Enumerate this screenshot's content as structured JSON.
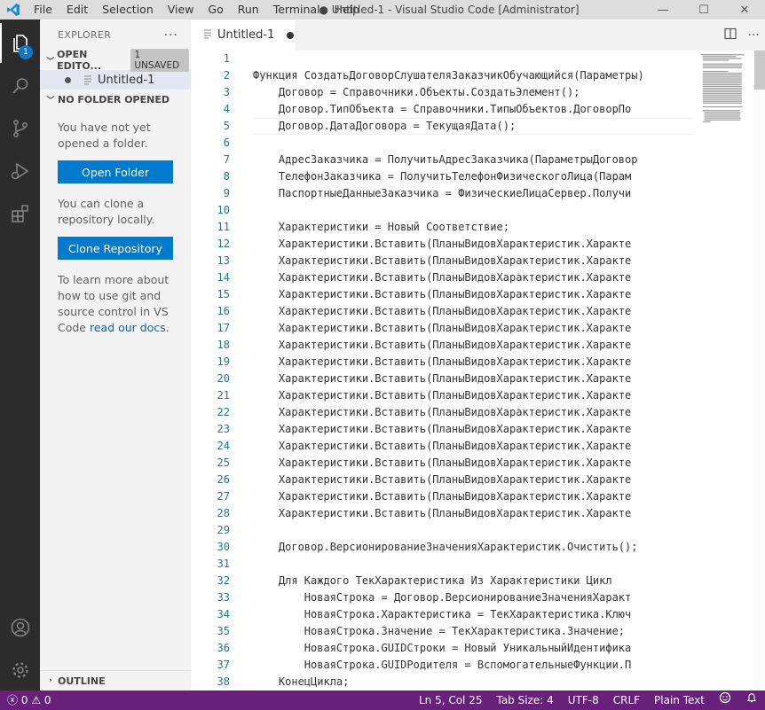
{
  "titlebar": {
    "menu": [
      "File",
      "Edit",
      "Selection",
      "View",
      "Go",
      "Run",
      "Terminal",
      "Help"
    ],
    "window_title": "● Untitled-1 - Visual Studio Code [Administrator]",
    "controls": {
      "minimize": "—",
      "maximize": "☐",
      "close": "✕"
    }
  },
  "activitybar": {
    "items": [
      "files-icon",
      "search-icon",
      "source-control-icon",
      "run-debug-icon",
      "extensions-icon"
    ],
    "explorer_badge": "1",
    "bottom": [
      "account-icon",
      "gear-icon"
    ]
  },
  "sidebar": {
    "title": "EXPLORER",
    "more": "···",
    "open_editors": {
      "label": "OPEN EDITO...",
      "badge": "1 UNSAVED",
      "file": "Untitled-1"
    },
    "no_folder": {
      "label": "NO FOLDER OPENED",
      "msg1": "You have not yet opened a folder.",
      "open_folder_button": "Open Folder",
      "msg2": "You can clone a repository locally.",
      "clone_button": "Clone Repository",
      "msg3_prefix": "To learn more about how to use git and source control in VS Code ",
      "msg3_link": "read our docs",
      "msg3_suffix": "."
    },
    "outline": "OUTLINE"
  },
  "editor": {
    "tab_label": "Untitled-1",
    "lines": [
      "",
      "Функция СоздатьДоговорСлушателяЗаказчикОбучающийся(Параметры)",
      "    Договор = Справочники.Объекты.СоздатьЭлемент();",
      "    Договор.ТипОбъекта = Справочники.ТипыОбъектов.ДоговорПо",
      "    Договор.ДатаДоговора = ТекущаяДата();",
      "",
      "    АдресЗаказчика = ПолучитьАдресЗаказчика(ПараметрыДоговор",
      "    ТелефонЗаказчика = ПолучитьТелефонФизическогоЛица(Парам",
      "    ПаспортныеДанныеЗаказчика = ФизическиеЛицаСервер.Получи",
      "",
      "    Характеристики = Новый Соответствие;",
      "    Характеристики.Вставить(ПланыВидовХарактеристик.Характе",
      "    Характеристики.Вставить(ПланыВидовХарактеристик.Характе",
      "    Характеристики.Вставить(ПланыВидовХарактеристик.Характе",
      "    Характеристики.Вставить(ПланыВидовХарактеристик.Характе",
      "    Характеристики.Вставить(ПланыВидовХарактеристик.Характе",
      "    Характеристики.Вставить(ПланыВидовХарактеристик.Характе",
      "    Характеристики.Вставить(ПланыВидовХарактеристик.Характе",
      "    Характеристики.Вставить(ПланыВидовХарактеристик.Характе",
      "    Характеристики.Вставить(ПланыВидовХарактеристик.Характе",
      "    Характеристики.Вставить(ПланыВидовХарактеристик.Характе",
      "    Характеристики.Вставить(ПланыВидовХарактеристик.Характе",
      "    Характеристики.Вставить(ПланыВидовХарактеристик.Характе",
      "    Характеристики.Вставить(ПланыВидовХарактеристик.Характе",
      "    Характеристики.Вставить(ПланыВидовХарактеристик.Характе",
      "    Характеристики.Вставить(ПланыВидовХарактеристик.Характе",
      "    Характеристики.Вставить(ПланыВидовХарактеристик.Характе",
      "    Характеристики.Вставить(ПланыВидовХарактеристик.Характе",
      "",
      "    Договор.ВерсионированиеЗначенияХарактеристик.Очистить();",
      "",
      "    Для Каждого ТекХарактеристика Из Характеристики Цикл",
      "        НоваяСтрока = Договор.ВерсионированиеЗначенияХаракт",
      "        НоваяСтрока.Характеристика = ТекХарактеристика.Ключ",
      "        НоваяСтрока.Значение = ТекХарактеристика.Значение;",
      "        НоваяСтрока.GUIDСтроки = Новый УникальныйИдентифика",
      "        НоваяСтрока.GUIDРодителя = ВспомогательныеФункции.П",
      "    КонецЦикла;"
    ],
    "current_line": 5
  },
  "statusbar": {
    "errors": "0",
    "warnings": "0",
    "position": "Ln 5, Col 25",
    "tab_size": "Tab Size: 4",
    "encoding": "UTF-8",
    "eol": "CRLF",
    "language": "Plain Text"
  },
  "colors": {
    "statusbar": "#68217a",
    "button": "#007acc",
    "activitybar": "#2c2c2c"
  }
}
